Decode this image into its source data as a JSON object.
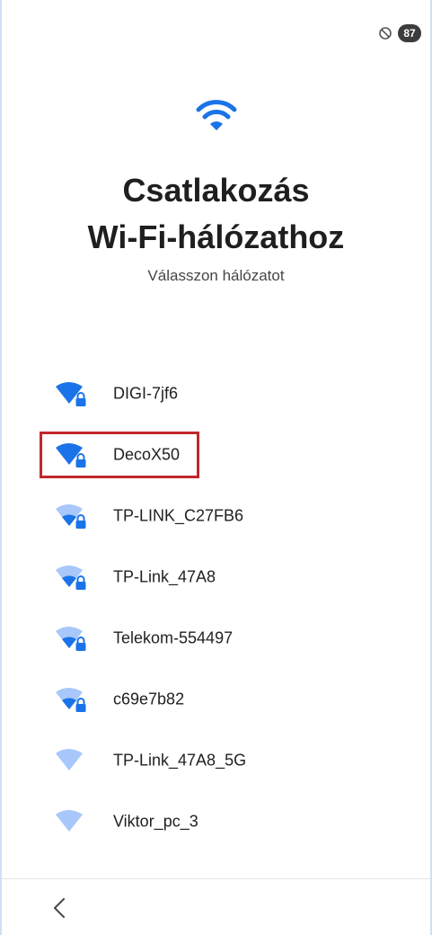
{
  "status_bar": {
    "dnd_icon": "do-not-disturb-icon",
    "battery_level": "87"
  },
  "header": {
    "icon": "wifi-icon",
    "title_line1": "Csatlakozás",
    "title_line2": "Wi-Fi-hálózathoz",
    "subtitle": "Válasszon hálózatot"
  },
  "networks": [
    {
      "ssid": "DIGI-7jf6",
      "signal": 4,
      "locked": true,
      "highlighted": false
    },
    {
      "ssid": "DecoX50",
      "signal": 4,
      "locked": true,
      "highlighted": true
    },
    {
      "ssid": "TP-LINK_C27FB6",
      "signal": 2,
      "locked": true,
      "highlighted": false
    },
    {
      "ssid": "TP-Link_47A8",
      "signal": 2,
      "locked": true,
      "highlighted": false
    },
    {
      "ssid": "Telekom-554497",
      "signal": 2,
      "locked": true,
      "highlighted": false
    },
    {
      "ssid": "c69e7b82",
      "signal": 2,
      "locked": true,
      "highlighted": false
    },
    {
      "ssid": "TP-Link_47A8_5G",
      "signal": 0,
      "locked": false,
      "highlighted": false
    },
    {
      "ssid": "Viktor_pc_3",
      "signal": 0,
      "locked": false,
      "highlighted": false
    }
  ],
  "navigation": {
    "back_icon": "chevron-left-icon"
  },
  "colors": {
    "wifi_strong": "#1a73e8",
    "wifi_weak": "#a8c7fa",
    "highlight": "#c2272d",
    "title": "#1f1f1f"
  }
}
